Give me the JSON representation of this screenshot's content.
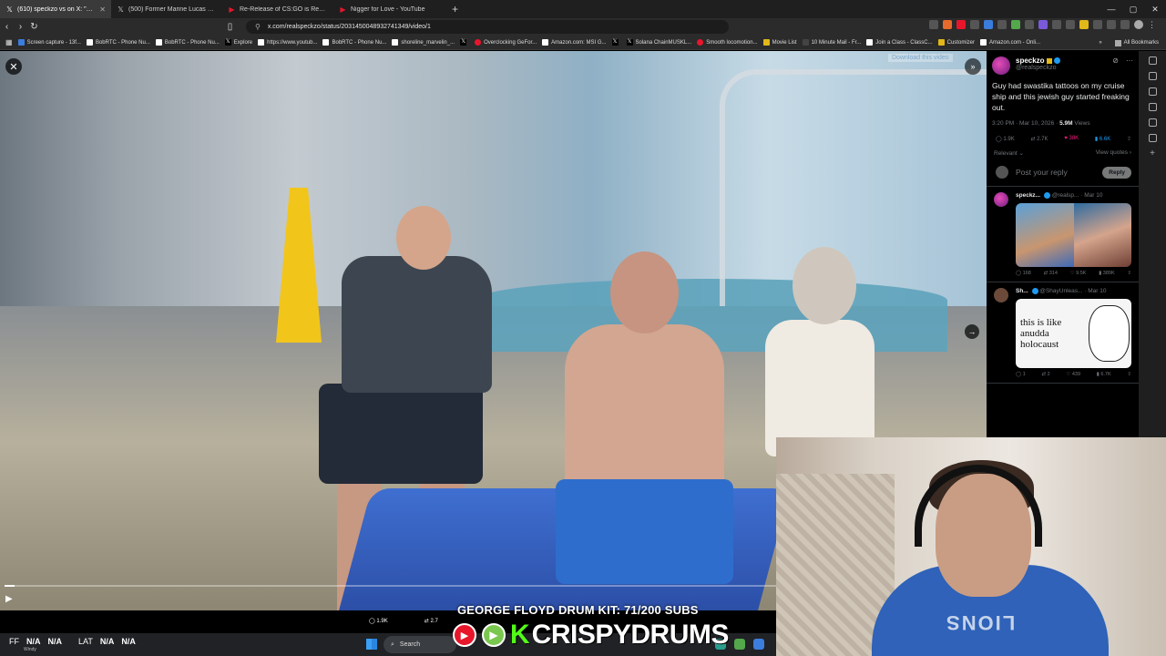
{
  "tabs": [
    {
      "icon": "x-logo",
      "label": "(610) speckzo vs on X: \"Guy had",
      "active": true
    },
    {
      "icon": "x-logo",
      "label": "(500) Former Marine Lucas Gage Re",
      "active": false
    },
    {
      "icon": "youtube-logo",
      "label": "Re-Release of CS:GO is Really Weird",
      "active": false
    },
    {
      "icon": "youtube-logo",
      "label": "Nigger for Love - YouTube",
      "active": false
    }
  ],
  "address": {
    "url": "x.com/realspeckzo/status/2031450048932741349/video/1"
  },
  "bookmarks": [
    {
      "label": "Screen capture - 13f...",
      "color": "#3b7ddd"
    },
    {
      "label": "BobRTC - Phone Nu...",
      "color": "#ffffff"
    },
    {
      "label": "BobRTC - Phone Nu...",
      "color": "#ffffff"
    },
    {
      "label": "Explore",
      "color": "#000000"
    },
    {
      "label": "https://www.youtub...",
      "color": "#ffffff"
    },
    {
      "label": "BobRTC - Phone Nu...",
      "color": "#ffffff"
    },
    {
      "label": "shoreline_marvelin_...",
      "color": "#ffffff"
    },
    {
      "label": "",
      "color": "#000000"
    },
    {
      "label": "Overclocking GeFor...",
      "color": "#e8162b"
    },
    {
      "label": "Amazon.com: MSI G...",
      "color": "#ffffff"
    },
    {
      "label": "",
      "color": "#000000"
    },
    {
      "label": "Solana ChainMUSKL...",
      "color": "#000000"
    },
    {
      "label": "Smooth locomotion...",
      "color": "#e8162b"
    },
    {
      "label": "Movie List",
      "color": "#e2b719"
    },
    {
      "label": "10 Minute Mail - Fr...",
      "color": "#444444"
    },
    {
      "label": "Join a Class - ClassC...",
      "color": "#ffffff"
    },
    {
      "label": "Customizer",
      "color": "#e2b719"
    },
    {
      "label": "Amazon.com - Onli...",
      "color": "#ffffff"
    }
  ],
  "bookmarks_right": "All Bookmarks",
  "video": {
    "download_hint": "Download this video",
    "progress_fraction": 0.01,
    "stats": [
      "1.9K",
      "2.7"
    ]
  },
  "post": {
    "name": "speckzo",
    "handle": "@realspeckzo",
    "text": "Guy had swastika tattoos on my cruise ship and this jewish guy started freaking out.",
    "time": "3:20 PM · Mar 10, 2026 ·",
    "views_count": "5.9M",
    "views_label": "Views",
    "stats": {
      "replies": "1.9K",
      "reposts": "2.7K",
      "likes": "38K",
      "bookmarks": "6.6K"
    },
    "sort_label": "Relevant",
    "view_quotes": "View quotes",
    "reply_placeholder": "Post your reply",
    "reply_button": "Reply"
  },
  "replies": [
    {
      "name": "speckz...",
      "handle": "@realsp...",
      "date": "· Mar 10",
      "stats": [
        "168",
        "314",
        "9.5K",
        "389K"
      ]
    },
    {
      "name": "Sh...",
      "handle": "@ShayUnleas...",
      "date": "· Mar 10",
      "meme_text": "this is like anudda holocaust",
      "stats": [
        "1",
        "2",
        "439",
        "6.7K"
      ]
    }
  ],
  "taskbar": {
    "temp_label": "FF",
    "temp_value": "N/A",
    "temp_value2": "N/A",
    "lat_label": "LAT",
    "lat_value": "N/A",
    "lat_value2": "N/A",
    "location": "Windy",
    "search": "Search"
  },
  "overlay": {
    "banner": "GEORGE FLOYD DRUM KIT: 71/200 SUBS",
    "kick_letter": "K",
    "brand": "CRISPYDRUMS"
  },
  "webcam": {
    "hoodie_text": "LIONS"
  }
}
